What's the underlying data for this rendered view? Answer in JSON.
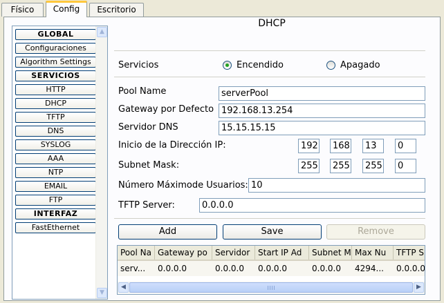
{
  "tabs": [
    {
      "label": "Físico"
    },
    {
      "label": "Config"
    },
    {
      "label": "Escritorio"
    }
  ],
  "active_tab": "Config",
  "sidebar": {
    "items": [
      {
        "label": "GLOBAL",
        "kind": "header"
      },
      {
        "label": "Configuraciones",
        "kind": "item"
      },
      {
        "label": "Algorithm Settings",
        "kind": "item"
      },
      {
        "label": "SERVICIOS",
        "kind": "header"
      },
      {
        "label": "HTTP",
        "kind": "item"
      },
      {
        "label": "DHCP",
        "kind": "item"
      },
      {
        "label": "TFTP",
        "kind": "item"
      },
      {
        "label": "DNS",
        "kind": "item"
      },
      {
        "label": "SYSLOG",
        "kind": "item"
      },
      {
        "label": "AAA",
        "kind": "item"
      },
      {
        "label": "NTP",
        "kind": "item"
      },
      {
        "label": "EMAIL",
        "kind": "item"
      },
      {
        "label": "FTP",
        "kind": "item"
      },
      {
        "label": "INTERFAZ",
        "kind": "header"
      },
      {
        "label": "FastEthernet",
        "kind": "item"
      }
    ]
  },
  "main": {
    "title": "DHCP",
    "service": {
      "label": "Servicios",
      "on_label": "Encendido",
      "off_label": "Apagado",
      "selected": "Encendido"
    },
    "pool_name": {
      "label": "Pool Name",
      "value": "serverPool"
    },
    "gateway": {
      "label": "Gateway por Defecto",
      "value": "192.168.13.254"
    },
    "dns": {
      "label": "Servidor DNS",
      "value": "15.15.15.15"
    },
    "start_ip": {
      "label": "Inicio de la Dirección IP:",
      "octets": [
        "192",
        "168",
        "13",
        "0"
      ]
    },
    "subnet": {
      "label": "Subnet Mask:",
      "octets": [
        "255",
        "255",
        "255",
        "0"
      ]
    },
    "max_users": {
      "label": "Número Máximode Usuarios:",
      "value": "10"
    },
    "tftp": {
      "label": "TFTP Server:",
      "value": "0.0.0.0"
    },
    "buttons": {
      "add": "Add",
      "save": "Save",
      "remove": "Remove"
    },
    "table": {
      "columns": [
        "Pool Na",
        "Gateway po",
        "Servidor",
        "Start IP Ad",
        "Subnet M",
        "Max Nu",
        "TFTP S"
      ],
      "rows": [
        [
          "serv...",
          "0.0.0.0",
          "0.0.0.0",
          "0.0.0.0",
          "0.0.0.0",
          "4294...",
          "0.0.0.0"
        ]
      ]
    }
  }
}
